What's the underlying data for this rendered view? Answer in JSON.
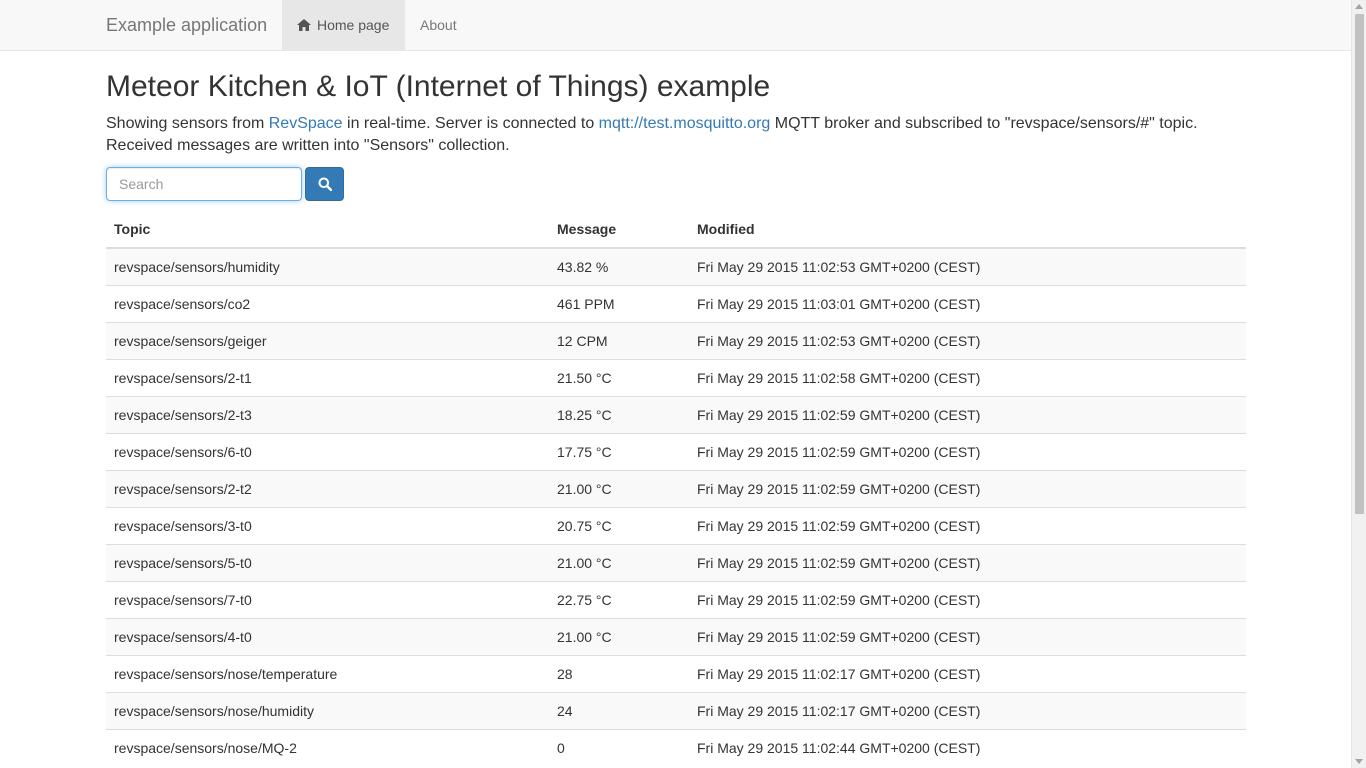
{
  "navbar": {
    "brand": "Example application",
    "home_label": "Home page",
    "about_label": "About"
  },
  "page": {
    "title": "Meteor Kitchen & IoT (Internet of Things) example",
    "desc_part1": "Showing sensors from ",
    "link_revspace": "RevSpace",
    "desc_part2": " in real-time. Server is connected to ",
    "link_mqtt": "mqtt://test.mosquitto.org",
    "desc_part3": " MQTT broker and subscribed to \"revspace/sensors/#\" topic. Received messages are written into \"Sensors\" collection."
  },
  "search": {
    "placeholder": "Search"
  },
  "table": {
    "headers": [
      "Topic",
      "Message",
      "Modified"
    ],
    "rows": [
      {
        "topic": "revspace/sensors/humidity",
        "message": "43.82 %",
        "modified": "Fri May 29 2015 11:02:53 GMT+0200 (CEST)"
      },
      {
        "topic": "revspace/sensors/co2",
        "message": "461 PPM",
        "modified": "Fri May 29 2015 11:03:01 GMT+0200 (CEST)"
      },
      {
        "topic": "revspace/sensors/geiger",
        "message": "12 CPM",
        "modified": "Fri May 29 2015 11:02:53 GMT+0200 (CEST)"
      },
      {
        "topic": "revspace/sensors/2-t1",
        "message": "21.50 °C",
        "modified": "Fri May 29 2015 11:02:58 GMT+0200 (CEST)"
      },
      {
        "topic": "revspace/sensors/2-t3",
        "message": "18.25 °C",
        "modified": "Fri May 29 2015 11:02:59 GMT+0200 (CEST)"
      },
      {
        "topic": "revspace/sensors/6-t0",
        "message": "17.75 °C",
        "modified": "Fri May 29 2015 11:02:59 GMT+0200 (CEST)"
      },
      {
        "topic": "revspace/sensors/2-t2",
        "message": "21.00 °C",
        "modified": "Fri May 29 2015 11:02:59 GMT+0200 (CEST)"
      },
      {
        "topic": "revspace/sensors/3-t0",
        "message": "20.75 °C",
        "modified": "Fri May 29 2015 11:02:59 GMT+0200 (CEST)"
      },
      {
        "topic": "revspace/sensors/5-t0",
        "message": "21.00 °C",
        "modified": "Fri May 29 2015 11:02:59 GMT+0200 (CEST)"
      },
      {
        "topic": "revspace/sensors/7-t0",
        "message": "22.75 °C",
        "modified": "Fri May 29 2015 11:02:59 GMT+0200 (CEST)"
      },
      {
        "topic": "revspace/sensors/4-t0",
        "message": "21.00 °C",
        "modified": "Fri May 29 2015 11:02:59 GMT+0200 (CEST)"
      },
      {
        "topic": "revspace/sensors/nose/temperature",
        "message": "28",
        "modified": "Fri May 29 2015 11:02:17 GMT+0200 (CEST)"
      },
      {
        "topic": "revspace/sensors/nose/humidity",
        "message": "24",
        "modified": "Fri May 29 2015 11:02:17 GMT+0200 (CEST)"
      },
      {
        "topic": "revspace/sensors/nose/MQ-2",
        "message": "0",
        "modified": "Fri May 29 2015 11:02:44 GMT+0200 (CEST)"
      }
    ]
  },
  "icons": {
    "home": "home-icon",
    "search": "search-icon"
  },
  "colors": {
    "link": "#337ab7",
    "primary_button": "#337ab7"
  }
}
